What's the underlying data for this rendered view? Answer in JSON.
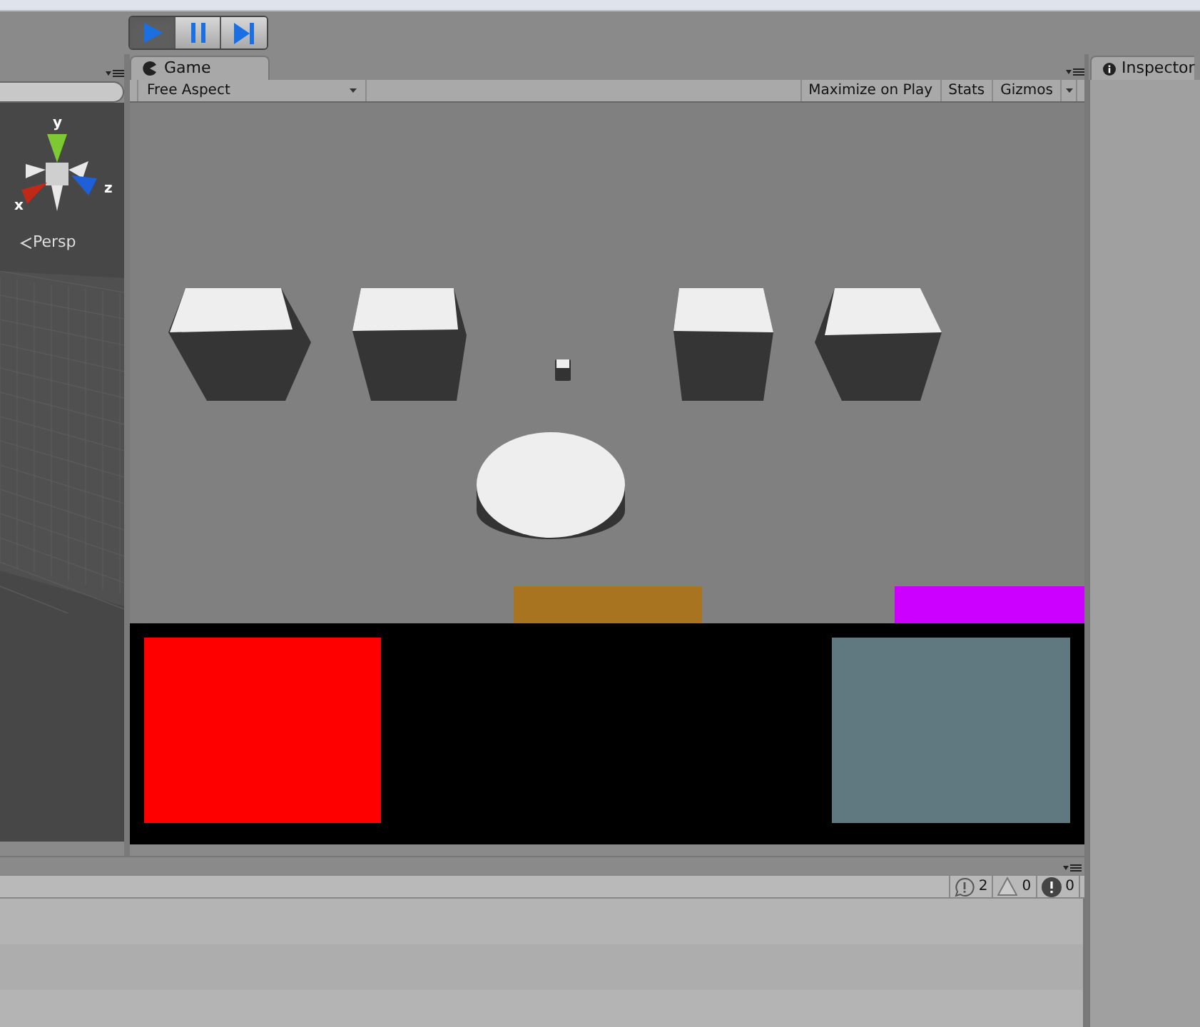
{
  "play_controls": [
    {
      "kind": "play",
      "selected": true
    },
    {
      "kind": "pause",
      "selected": false
    },
    {
      "kind": "step",
      "selected": false
    }
  ],
  "scene": {
    "axes": [
      "y",
      "z",
      "x"
    ],
    "projection": "Persp"
  },
  "game": {
    "tab": "Game",
    "aspect": "Free Aspect",
    "buttons": [
      "Maximize on Play",
      "Stats",
      "Gizmos"
    ]
  },
  "inspector": {
    "tab": "Inspector"
  },
  "console": {
    "counters": [
      {
        "kind": "info",
        "count": "2"
      },
      {
        "kind": "warning",
        "count": "0"
      },
      {
        "kind": "error",
        "count": "0"
      }
    ]
  }
}
